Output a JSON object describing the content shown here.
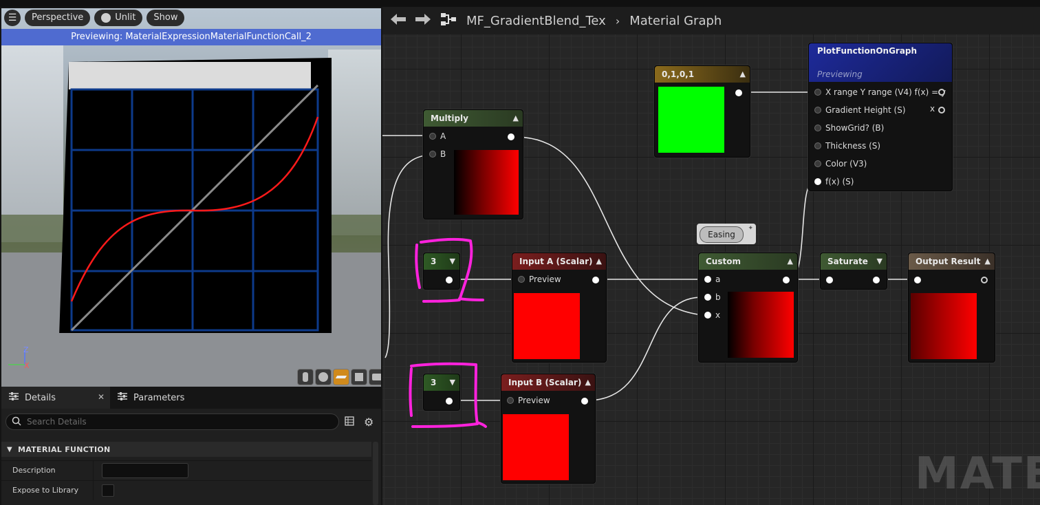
{
  "viewport": {
    "toolbar": {
      "perspective": "Perspective",
      "unlit": "Unlit",
      "show": "Show"
    },
    "banner": "Previewing: MaterialExpressionMaterialFunctionCall_2",
    "axis": {
      "z": "Z",
      "x": "X"
    }
  },
  "details": {
    "tabs": [
      {
        "label": "Details"
      },
      {
        "label": "Parameters"
      }
    ],
    "search_placeholder": "Search Details",
    "section": "MATERIAL FUNCTION",
    "props": [
      {
        "label": "Description"
      },
      {
        "label": "Expose to Library"
      }
    ]
  },
  "graph": {
    "breadcrumb": {
      "asset": "MF_GradientBlend_Tex",
      "graph": "Material Graph"
    },
    "watermark": "MATER"
  },
  "nodes": {
    "multiply": {
      "title": "Multiply",
      "pins": [
        "A",
        "B"
      ]
    },
    "vector": {
      "title": "0,1,0,1"
    },
    "plot": {
      "title": "PlotFunctionOnGraph",
      "subtitle": "Previewing",
      "pins": [
        "X range Y range (V4) f(x) = y",
        "Gradient Height (S)",
        "ShowGrid? (B)",
        "Thickness (S)",
        "Color (V3)",
        "f(x) (S)"
      ],
      "out_label": "x"
    },
    "const1": {
      "value": "3"
    },
    "const2": {
      "value": "3"
    },
    "input_a": {
      "title": "Input A (Scalar)",
      "pin": "Preview"
    },
    "input_b": {
      "title": "Input B (Scalar)",
      "pin": "Preview"
    },
    "custom": {
      "title": "Custom",
      "pins": [
        "a",
        "b",
        "x"
      ],
      "comment": "Easing"
    },
    "saturate": {
      "title": "Saturate"
    },
    "output": {
      "title": "Output Result"
    }
  },
  "colors": {
    "accent_blue": "#4f6bd0",
    "node_green": "#3f5a33",
    "node_red": "#6e1e1e",
    "annotation": "#ff22dd",
    "swatch_red": "#ff0000",
    "swatch_green": "#00ff00"
  }
}
